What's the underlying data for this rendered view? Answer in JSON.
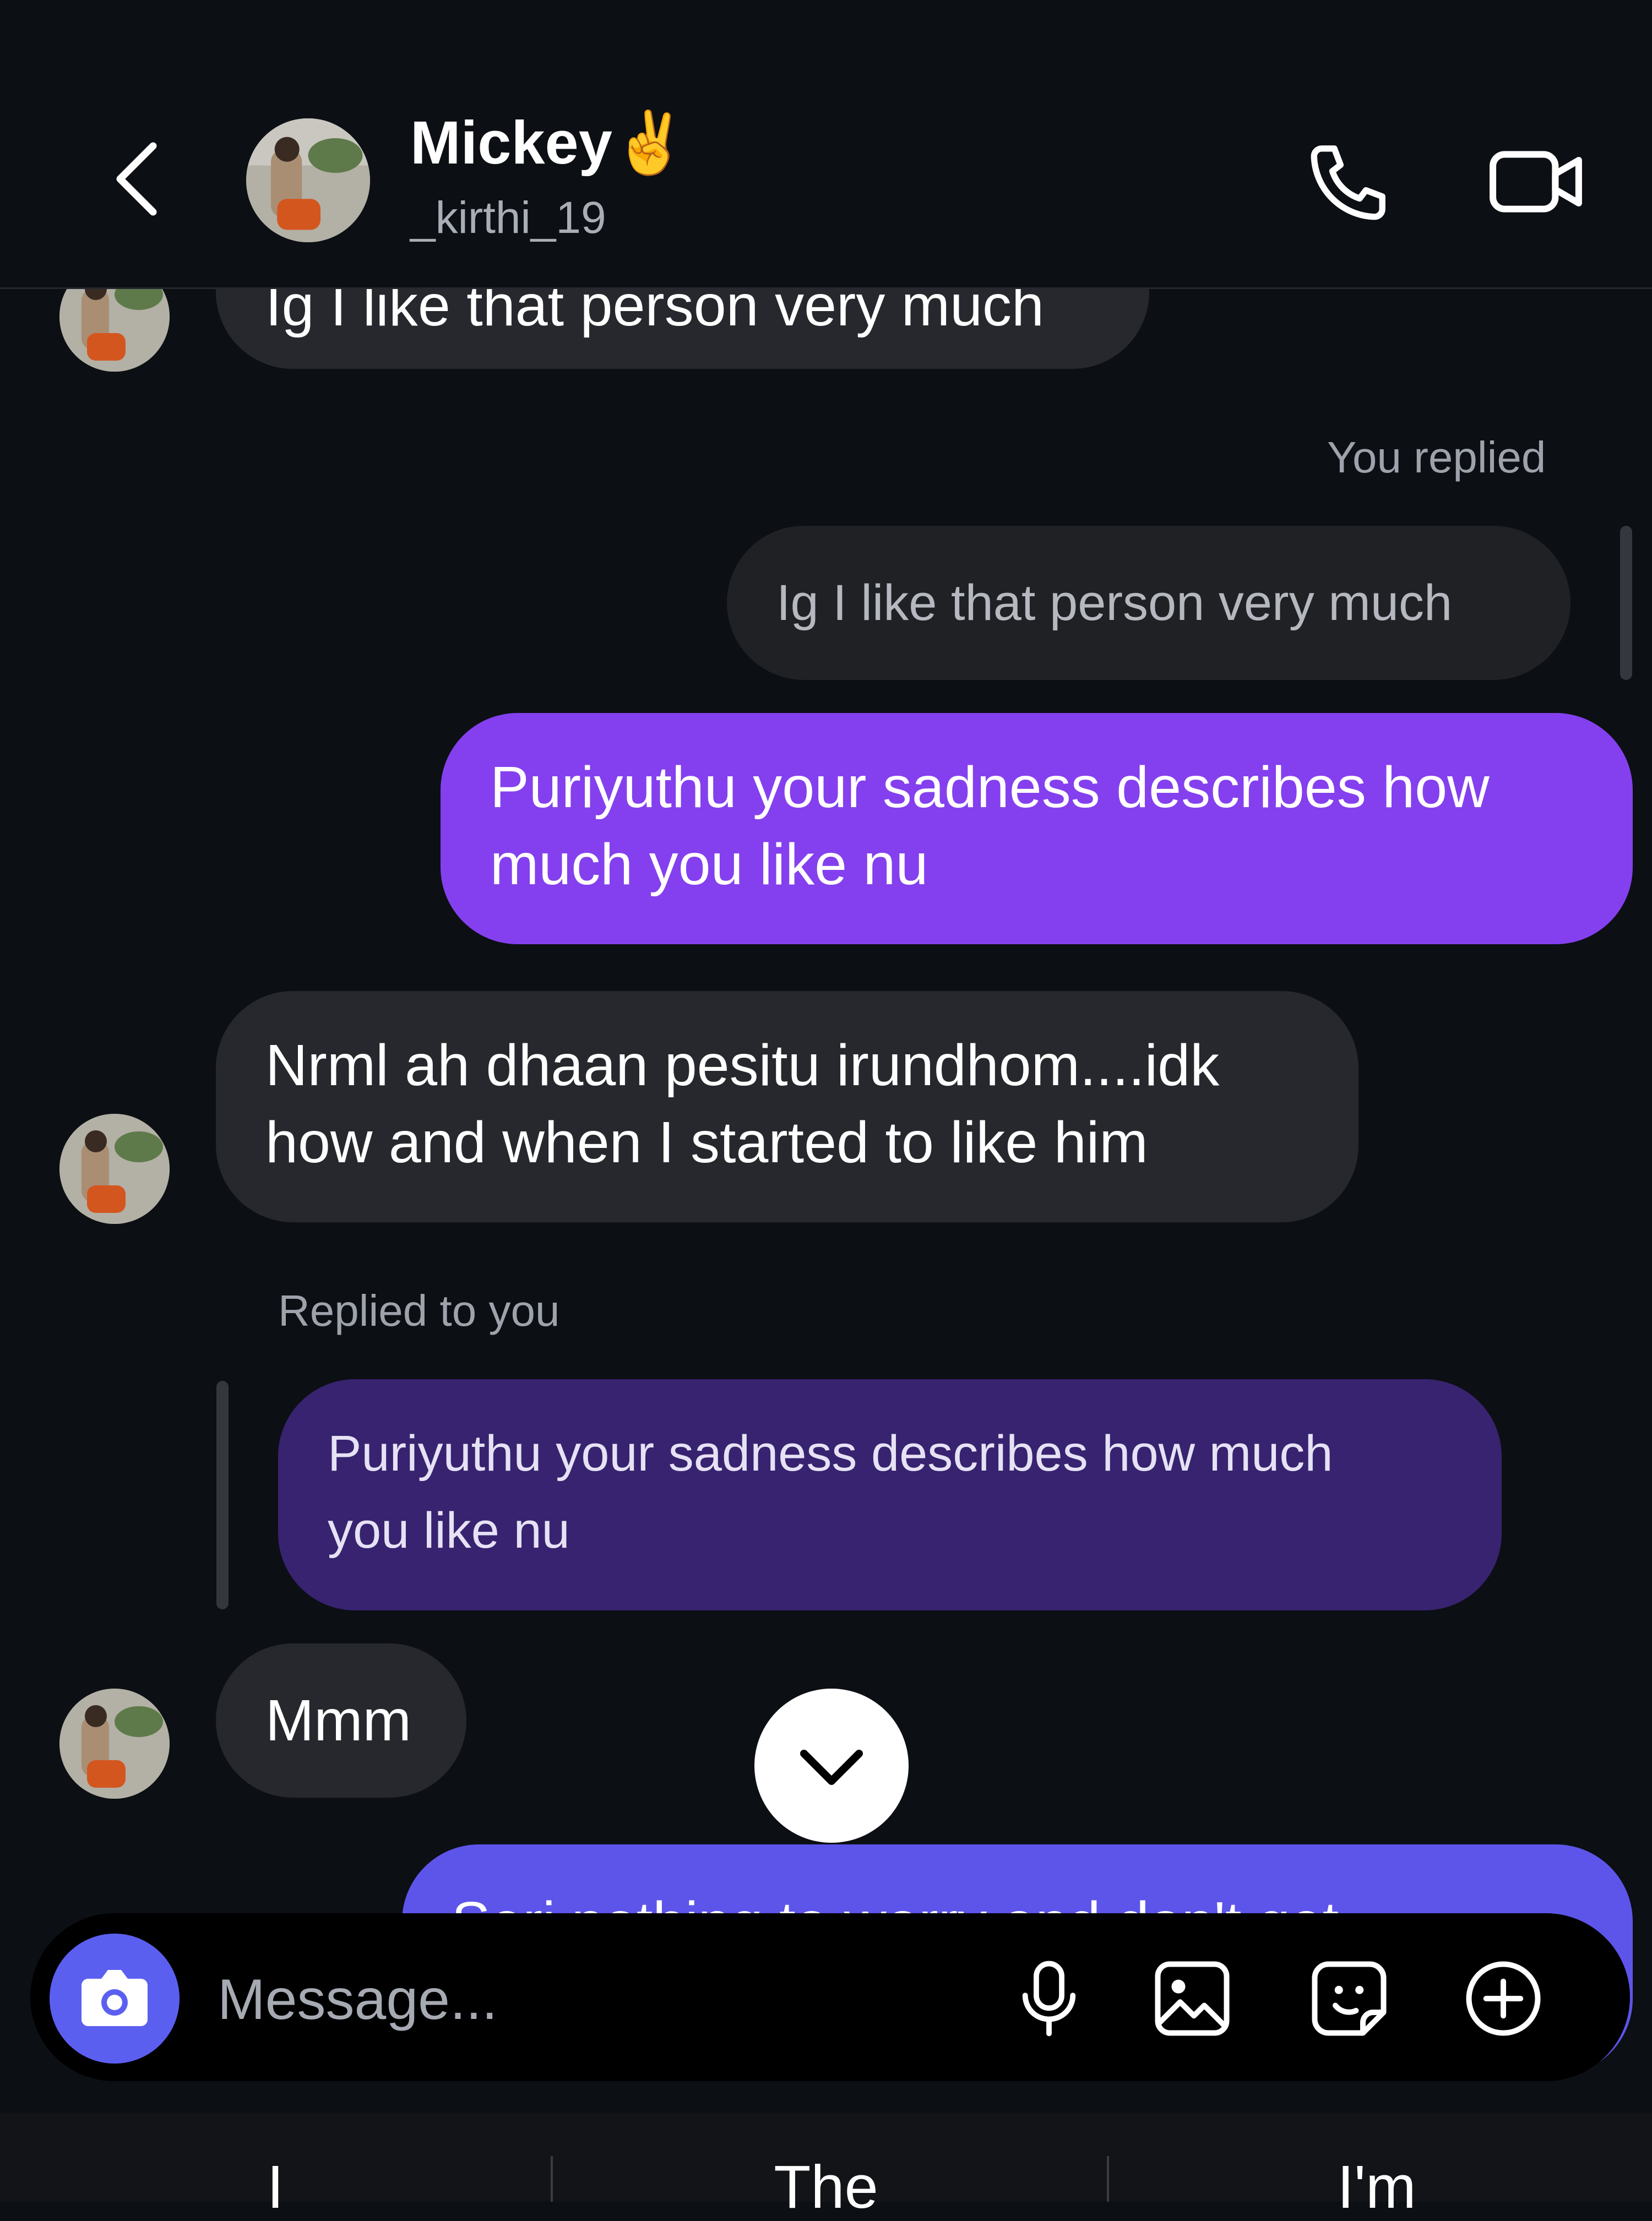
{
  "header": {
    "contact_name": "Mickey✌️",
    "contact_handle": "_kirthi_19",
    "icons": [
      "back-chevron-icon",
      "phone-icon",
      "video-camera-icon"
    ]
  },
  "messages": {
    "top_partial": "Ig I like that person very much",
    "you_replied_label": "You replied",
    "quoted_incoming": "Ig I like that person very much",
    "outgoing_1_line1": "Puriyuthu your sadness describes how",
    "outgoing_1_line2": "much you like nu",
    "incoming_1_line1": "Nrml ah dhaan pesitu irundhom....idk",
    "incoming_1_line2": "how and when I started to like him",
    "replied_to_you_label": "Replied to you",
    "quoted_outgoing_line1": "Puriyuthu your sadness describes how much",
    "quoted_outgoing_line2": "you like nu",
    "incoming_2": "Mmm",
    "outgoing_partial": "Seri nothing to worry and don't get"
  },
  "composer": {
    "placeholder": "Message...",
    "icons": [
      "camera-icon",
      "microphone-icon",
      "gallery-icon",
      "sticker-icon",
      "add-icon"
    ]
  },
  "keyboard": {
    "suggestions": [
      "I",
      "The",
      "I'm"
    ]
  },
  "colors": {
    "background": "#0c0f14",
    "incoming_bubble": "#26282d",
    "outgoing_bubble": "#8440ee",
    "quoted_outgoing_bubble": "#37236f",
    "camera_button": "#5b5ff0"
  }
}
